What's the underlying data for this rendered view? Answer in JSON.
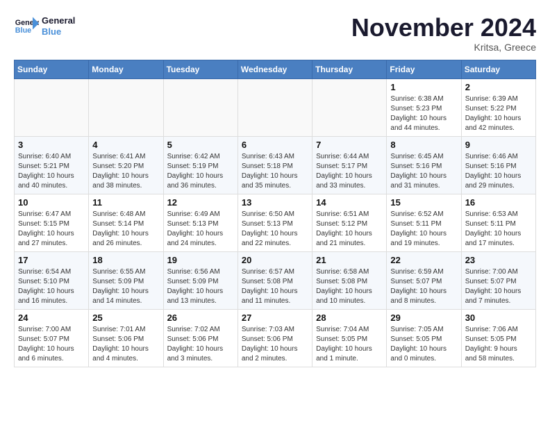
{
  "header": {
    "logo_general": "General",
    "logo_blue": "Blue",
    "month_title": "November 2024",
    "location": "Kritsa, Greece"
  },
  "days_of_week": [
    "Sunday",
    "Monday",
    "Tuesday",
    "Wednesday",
    "Thursday",
    "Friday",
    "Saturday"
  ],
  "weeks": [
    [
      {
        "day": "",
        "info": ""
      },
      {
        "day": "",
        "info": ""
      },
      {
        "day": "",
        "info": ""
      },
      {
        "day": "",
        "info": ""
      },
      {
        "day": "",
        "info": ""
      },
      {
        "day": "1",
        "info": "Sunrise: 6:38 AM\nSunset: 5:23 PM\nDaylight: 10 hours\nand 44 minutes."
      },
      {
        "day": "2",
        "info": "Sunrise: 6:39 AM\nSunset: 5:22 PM\nDaylight: 10 hours\nand 42 minutes."
      }
    ],
    [
      {
        "day": "3",
        "info": "Sunrise: 6:40 AM\nSunset: 5:21 PM\nDaylight: 10 hours\nand 40 minutes."
      },
      {
        "day": "4",
        "info": "Sunrise: 6:41 AM\nSunset: 5:20 PM\nDaylight: 10 hours\nand 38 minutes."
      },
      {
        "day": "5",
        "info": "Sunrise: 6:42 AM\nSunset: 5:19 PM\nDaylight: 10 hours\nand 36 minutes."
      },
      {
        "day": "6",
        "info": "Sunrise: 6:43 AM\nSunset: 5:18 PM\nDaylight: 10 hours\nand 35 minutes."
      },
      {
        "day": "7",
        "info": "Sunrise: 6:44 AM\nSunset: 5:17 PM\nDaylight: 10 hours\nand 33 minutes."
      },
      {
        "day": "8",
        "info": "Sunrise: 6:45 AM\nSunset: 5:16 PM\nDaylight: 10 hours\nand 31 minutes."
      },
      {
        "day": "9",
        "info": "Sunrise: 6:46 AM\nSunset: 5:16 PM\nDaylight: 10 hours\nand 29 minutes."
      }
    ],
    [
      {
        "day": "10",
        "info": "Sunrise: 6:47 AM\nSunset: 5:15 PM\nDaylight: 10 hours\nand 27 minutes."
      },
      {
        "day": "11",
        "info": "Sunrise: 6:48 AM\nSunset: 5:14 PM\nDaylight: 10 hours\nand 26 minutes."
      },
      {
        "day": "12",
        "info": "Sunrise: 6:49 AM\nSunset: 5:13 PM\nDaylight: 10 hours\nand 24 minutes."
      },
      {
        "day": "13",
        "info": "Sunrise: 6:50 AM\nSunset: 5:13 PM\nDaylight: 10 hours\nand 22 minutes."
      },
      {
        "day": "14",
        "info": "Sunrise: 6:51 AM\nSunset: 5:12 PM\nDaylight: 10 hours\nand 21 minutes."
      },
      {
        "day": "15",
        "info": "Sunrise: 6:52 AM\nSunset: 5:11 PM\nDaylight: 10 hours\nand 19 minutes."
      },
      {
        "day": "16",
        "info": "Sunrise: 6:53 AM\nSunset: 5:11 PM\nDaylight: 10 hours\nand 17 minutes."
      }
    ],
    [
      {
        "day": "17",
        "info": "Sunrise: 6:54 AM\nSunset: 5:10 PM\nDaylight: 10 hours\nand 16 minutes."
      },
      {
        "day": "18",
        "info": "Sunrise: 6:55 AM\nSunset: 5:09 PM\nDaylight: 10 hours\nand 14 minutes."
      },
      {
        "day": "19",
        "info": "Sunrise: 6:56 AM\nSunset: 5:09 PM\nDaylight: 10 hours\nand 13 minutes."
      },
      {
        "day": "20",
        "info": "Sunrise: 6:57 AM\nSunset: 5:08 PM\nDaylight: 10 hours\nand 11 minutes."
      },
      {
        "day": "21",
        "info": "Sunrise: 6:58 AM\nSunset: 5:08 PM\nDaylight: 10 hours\nand 10 minutes."
      },
      {
        "day": "22",
        "info": "Sunrise: 6:59 AM\nSunset: 5:07 PM\nDaylight: 10 hours\nand 8 minutes."
      },
      {
        "day": "23",
        "info": "Sunrise: 7:00 AM\nSunset: 5:07 PM\nDaylight: 10 hours\nand 7 minutes."
      }
    ],
    [
      {
        "day": "24",
        "info": "Sunrise: 7:00 AM\nSunset: 5:07 PM\nDaylight: 10 hours\nand 6 minutes."
      },
      {
        "day": "25",
        "info": "Sunrise: 7:01 AM\nSunset: 5:06 PM\nDaylight: 10 hours\nand 4 minutes."
      },
      {
        "day": "26",
        "info": "Sunrise: 7:02 AM\nSunset: 5:06 PM\nDaylight: 10 hours\nand 3 minutes."
      },
      {
        "day": "27",
        "info": "Sunrise: 7:03 AM\nSunset: 5:06 PM\nDaylight: 10 hours\nand 2 minutes."
      },
      {
        "day": "28",
        "info": "Sunrise: 7:04 AM\nSunset: 5:05 PM\nDaylight: 10 hours\nand 1 minute."
      },
      {
        "day": "29",
        "info": "Sunrise: 7:05 AM\nSunset: 5:05 PM\nDaylight: 10 hours\nand 0 minutes."
      },
      {
        "day": "30",
        "info": "Sunrise: 7:06 AM\nSunset: 5:05 PM\nDaylight: 9 hours\nand 58 minutes."
      }
    ]
  ]
}
